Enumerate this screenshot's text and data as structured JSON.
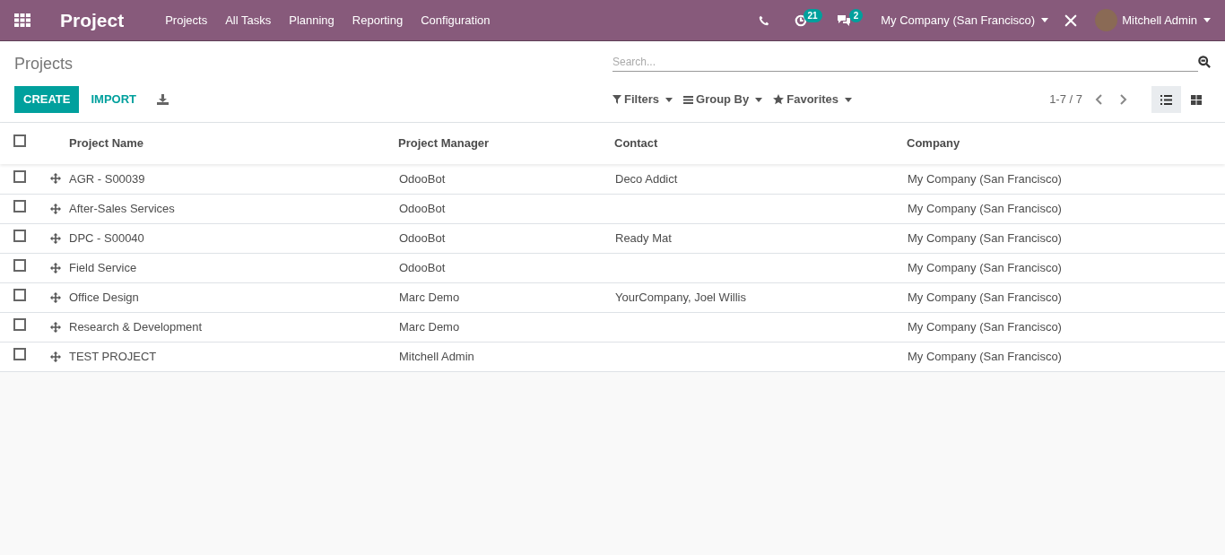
{
  "navbar": {
    "app_title": "Project",
    "menu": [
      "Projects",
      "All Tasks",
      "Planning",
      "Reporting",
      "Configuration"
    ],
    "activity_count": "21",
    "message_count": "2",
    "company": "My Company (San Francisco)",
    "user": "Mitchell Admin"
  },
  "control_panel": {
    "breadcrumb": "Projects",
    "search": {
      "placeholder": "Search..."
    },
    "buttons": [
      "CREATE",
      "IMPORT"
    ],
    "filters": [
      "Filters",
      "Group By",
      "Favorites"
    ],
    "pager": "1-7 / 7",
    "views": [
      {
        "kind": "list",
        "selected": true
      },
      {
        "kind": "kanban",
        "selected": false
      }
    ]
  },
  "table": {
    "select_all": {
      "checked": false
    },
    "columns": [
      "Project Name",
      "Project Manager",
      "Contact",
      "Company"
    ],
    "rows": [
      {
        "checked": false,
        "cells": [
          "AGR - S00039",
          "OdooBot",
          "Deco Addict",
          "My Company (San Francisco)"
        ]
      },
      {
        "checked": false,
        "cells": [
          "After-Sales Services",
          "OdooBot",
          "",
          "My Company (San Francisco)"
        ]
      },
      {
        "checked": false,
        "cells": [
          "DPC - S00040",
          "OdooBot",
          "Ready Mat",
          "My Company (San Francisco)"
        ]
      },
      {
        "checked": false,
        "cells": [
          "Field Service",
          "OdooBot",
          "",
          "My Company (San Francisco)"
        ]
      },
      {
        "checked": false,
        "cells": [
          "Office Design",
          "Marc Demo",
          "YourCompany, Joel Willis",
          "My Company (San Francisco)"
        ]
      },
      {
        "checked": false,
        "cells": [
          "Research & Development",
          "Marc Demo",
          "",
          "My Company (San Francisco)"
        ]
      },
      {
        "checked": false,
        "cells": [
          "TEST PROJECT",
          "Mitchell Admin",
          "",
          "My Company (San Francisco)"
        ]
      }
    ]
  }
}
